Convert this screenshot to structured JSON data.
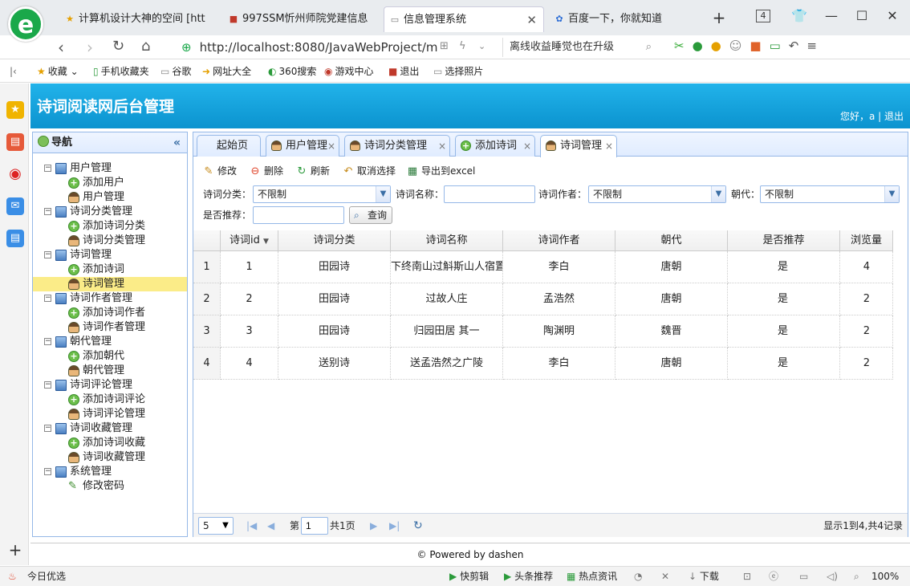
{
  "browser": {
    "logo": "e",
    "tabs": [
      {
        "label": "计算机设计大神的空间 [htt",
        "fav": "★"
      },
      {
        "label": "997SSM忻州师院党建信息",
        "fav": "■"
      },
      {
        "label": "信息管理系统",
        "fav": "▭"
      },
      {
        "label": "百度一下，你就知道",
        "fav": "✿"
      }
    ],
    "new_tab": "+",
    "tab_count": "4",
    "url": "http://localhost:8080/JavaWebProject/m",
    "news": "离线收益睡觉也在升级",
    "bookmarks": [
      "收藏",
      "手机收藏夹",
      "谷歌",
      "网址大全",
      "360搜索",
      "游戏中心",
      "退出",
      "选择照片"
    ],
    "status_left": "今日优选",
    "status_items": [
      "快剪辑",
      "头条推荐",
      "热点资讯",
      "下载"
    ],
    "zoom": "100%"
  },
  "app": {
    "title": "诗词阅读网后台管理",
    "user_info": "您好，a | 退出",
    "footer": "© Powered by dashen"
  },
  "nav": {
    "title": "导航",
    "collapse": "«",
    "groups": [
      {
        "label": "用户管理",
        "items": [
          {
            "label": "添加用户",
            "icon": "add"
          },
          {
            "label": "用户管理",
            "icon": "user"
          }
        ]
      },
      {
        "label": "诗词分类管理",
        "items": [
          {
            "label": "添加诗词分类",
            "icon": "add"
          },
          {
            "label": "诗词分类管理",
            "icon": "user"
          }
        ]
      },
      {
        "label": "诗词管理",
        "items": [
          {
            "label": "添加诗词",
            "icon": "add"
          },
          {
            "label": "诗词管理",
            "icon": "user",
            "selected": true
          }
        ]
      },
      {
        "label": "诗词作者管理",
        "items": [
          {
            "label": "添加诗词作者",
            "icon": "add"
          },
          {
            "label": "诗词作者管理",
            "icon": "user"
          }
        ]
      },
      {
        "label": "朝代管理",
        "items": [
          {
            "label": "添加朝代",
            "icon": "add"
          },
          {
            "label": "朝代管理",
            "icon": "user"
          }
        ]
      },
      {
        "label": "诗词评论管理",
        "items": [
          {
            "label": "添加诗词评论",
            "icon": "add"
          },
          {
            "label": "诗词评论管理",
            "icon": "user"
          }
        ]
      },
      {
        "label": "诗词收藏管理",
        "items": [
          {
            "label": "添加诗词收藏",
            "icon": "add"
          },
          {
            "label": "诗词收藏管理",
            "icon": "user"
          }
        ]
      },
      {
        "label": "系统管理",
        "items": [
          {
            "label": "修改密码",
            "icon": "pencil"
          }
        ]
      }
    ]
  },
  "tabs": [
    {
      "label": "起始页",
      "closable": false,
      "icon": "none"
    },
    {
      "label": "用户管理",
      "closable": true,
      "icon": "user"
    },
    {
      "label": "诗词分类管理",
      "closable": true,
      "icon": "user"
    },
    {
      "label": "添加诗词",
      "closable": true,
      "icon": "add"
    },
    {
      "label": "诗词管理",
      "closable": true,
      "icon": "user",
      "active": true
    }
  ],
  "toolbar": {
    "edit": "修改",
    "delete": "删除",
    "refresh": "刷新",
    "cancel_select": "取消选择",
    "export": "导出到excel"
  },
  "filters": {
    "category_label": "诗词分类：",
    "category_value": "不限制",
    "name_label": "诗词名称：",
    "name_value": "",
    "author_label": "诗词作者：",
    "author_value": "不限制",
    "dynasty_label": "朝代：",
    "dynasty_value": "不限制",
    "recommend_label": "是否推荐：",
    "recommend_value": "",
    "search_button": "查询"
  },
  "grid": {
    "columns": [
      "诗词id",
      "诗词分类",
      "诗词名称",
      "诗词作者",
      "朝代",
      "是否推荐",
      "浏览量"
    ],
    "sort_indicator": "▼",
    "rows": [
      {
        "num": "1",
        "id": "1",
        "category": "田园诗",
        "name": "下终南山过斛斯山人宿置",
        "author": "李白",
        "dynasty": "唐朝",
        "recommend": "是",
        "views": "4"
      },
      {
        "num": "2",
        "id": "2",
        "category": "田园诗",
        "name": "过故人庄",
        "author": "孟浩然",
        "dynasty": "唐朝",
        "recommend": "是",
        "views": "2"
      },
      {
        "num": "3",
        "id": "3",
        "category": "田园诗",
        "name": "归园田居 其一",
        "author": "陶渊明",
        "dynasty": "魏晋",
        "recommend": "是",
        "views": "2"
      },
      {
        "num": "4",
        "id": "4",
        "category": "送别诗",
        "name": "送孟浩然之广陵",
        "author": "李白",
        "dynasty": "唐朝",
        "recommend": "是",
        "views": "2"
      }
    ]
  },
  "pager": {
    "page_size": "5",
    "page_prefix": "第",
    "page_value": "1",
    "page_suffix": "共1页",
    "summary": "显示1到4,共4记录"
  }
}
